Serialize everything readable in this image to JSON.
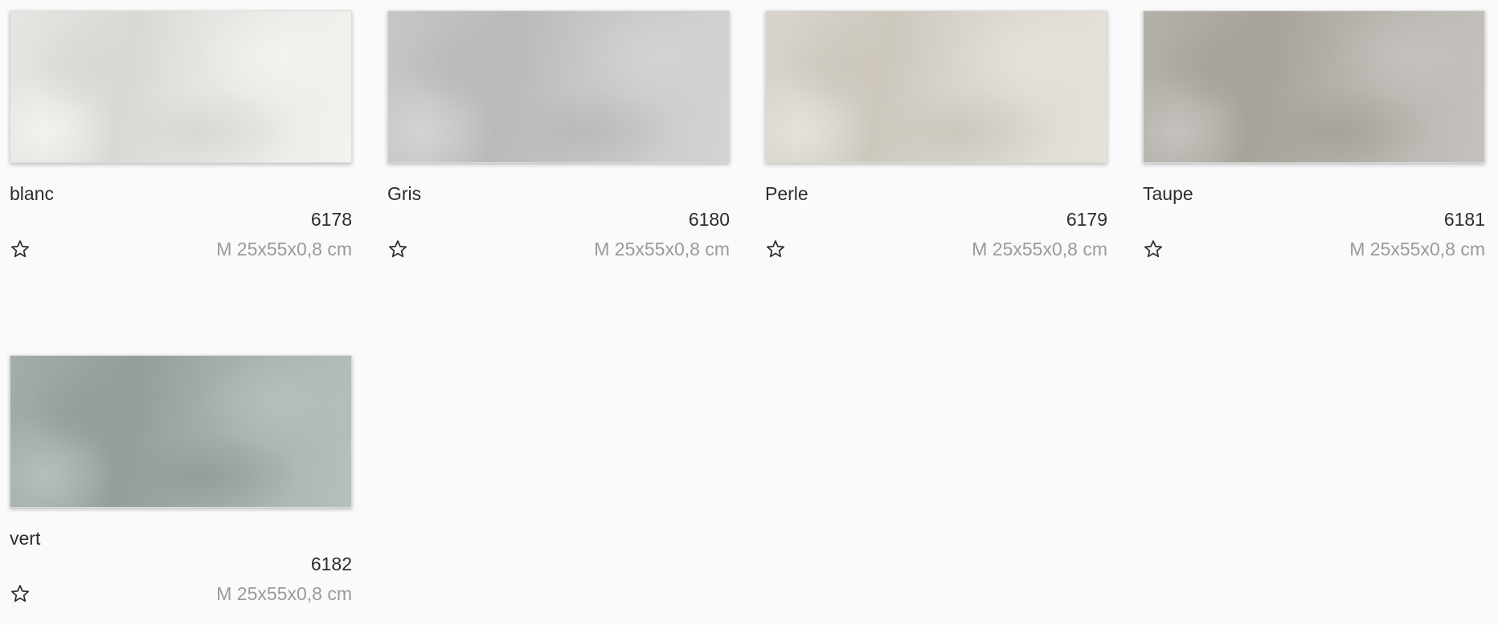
{
  "tiles": [
    {
      "name": "blanc",
      "code": "6178",
      "size": "M 25x55x0,8 cm",
      "favorite_icon": "star-outline-icon",
      "colors": {
        "base": "#e6e5e2",
        "light": "#f3f2ef",
        "dark": "#d9d8d4"
      }
    },
    {
      "name": "Gris",
      "code": "6180",
      "size": "M 25x55x0,8 cm",
      "favorite_icon": "star-outline-icon",
      "colors": {
        "base": "#c6c6c6",
        "light": "#d3d3d3",
        "dark": "#b9b9b9"
      }
    },
    {
      "name": "Perle",
      "code": "6179",
      "size": "M 25x55x0,8 cm",
      "favorite_icon": "star-outline-icon",
      "colors": {
        "base": "#d9d5cc",
        "light": "#e6e2da",
        "dark": "#cdc8be"
      }
    },
    {
      "name": "Taupe",
      "code": "6181",
      "size": "M 25x55x0,8 cm",
      "favorite_icon": "star-outline-icon",
      "colors": {
        "base": "#b4b0aa",
        "light": "#c5c2bd",
        "dark": "#a7a29b"
      }
    },
    {
      "name": "vert",
      "code": "6182",
      "size": "M 25x55x0,8 cm",
      "favorite_icon": "star-outline-icon",
      "colors": {
        "base": "#a2aca8",
        "light": "#b7bfbc",
        "dark": "#939e9a"
      }
    }
  ]
}
